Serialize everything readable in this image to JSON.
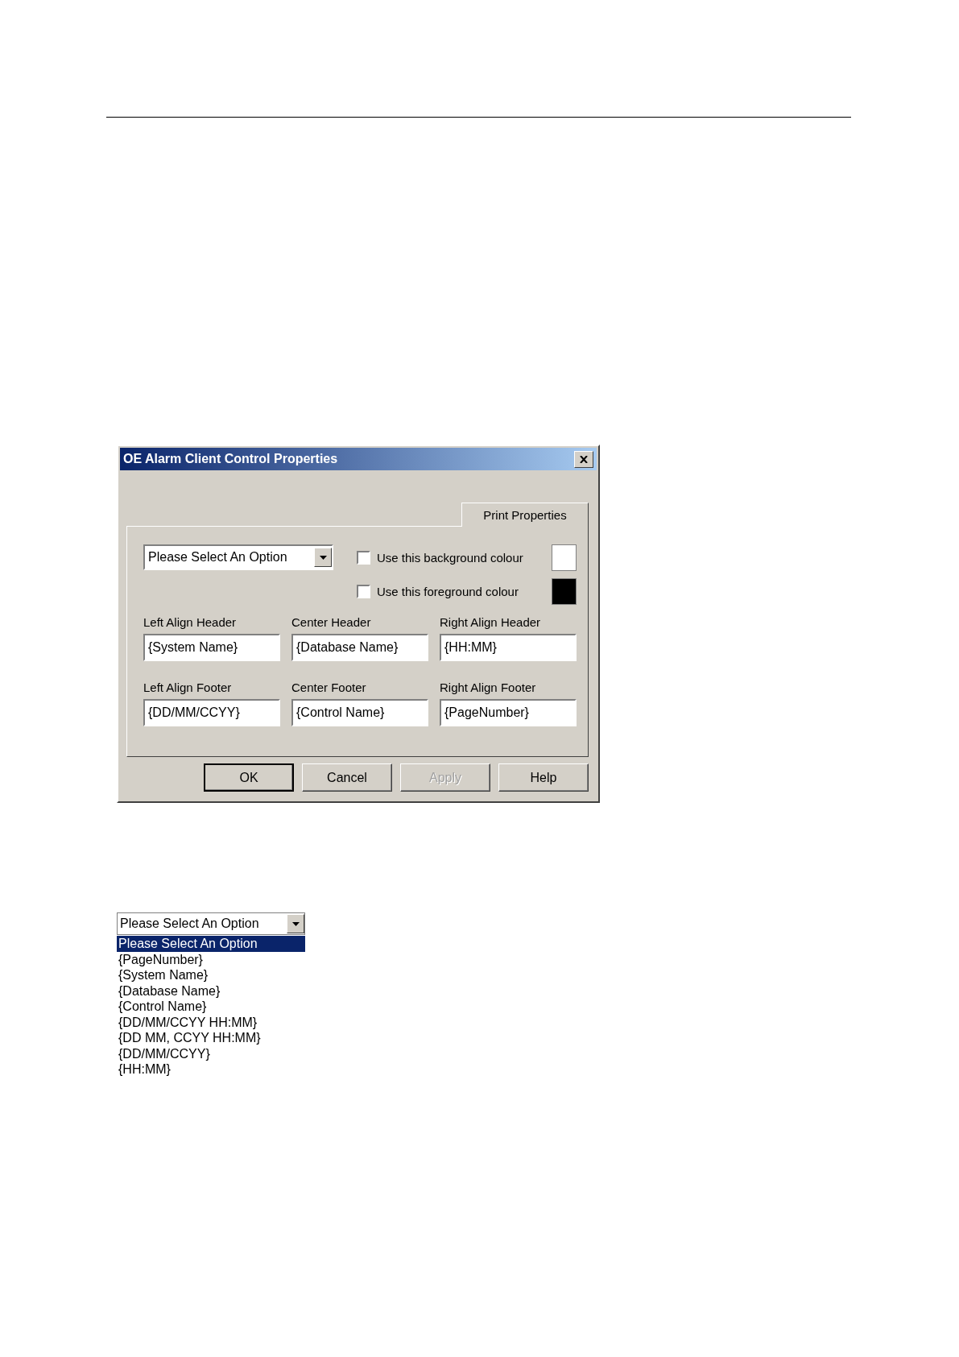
{
  "dialog": {
    "title": "OE Alarm Client Control Properties",
    "tabs": [
      {
        "label": "Print Properties",
        "selected": true
      }
    ],
    "option_select": {
      "value": "Please Select An Option"
    },
    "colour_options": [
      {
        "label": "Use this background colour",
        "checked": false,
        "color": "#ffffff"
      },
      {
        "label": "Use this foreground colour",
        "checked": false,
        "color": "#000000"
      }
    ],
    "fields": [
      {
        "label": "Left Align Header",
        "value": "{System Name}"
      },
      {
        "label": "Center Header",
        "value": "{Database Name}"
      },
      {
        "label": "Right Align Header",
        "value": "{HH:MM}"
      },
      {
        "label": "Left Align Footer",
        "value": "{DD/MM/CCYY}"
      },
      {
        "label": "Center Footer",
        "value": "{Control Name}"
      },
      {
        "label": "Right Align Footer",
        "value": "{PageNumber}"
      }
    ],
    "buttons": [
      {
        "label": "OK",
        "default": true,
        "disabled": false
      },
      {
        "label": "Cancel",
        "default": false,
        "disabled": false
      },
      {
        "label": "Apply",
        "default": false,
        "disabled": true
      },
      {
        "label": "Help",
        "default": false,
        "disabled": false
      }
    ]
  },
  "dropdown_demo": {
    "value": "Please Select An Option",
    "options": [
      {
        "label": "Please Select An Option",
        "selected": true
      },
      {
        "label": "{PageNumber}",
        "selected": false
      },
      {
        "label": "{System Name}",
        "selected": false
      },
      {
        "label": "{Database Name}",
        "selected": false
      },
      {
        "label": "{Control Name}",
        "selected": false
      },
      {
        "label": "{DD/MM/CCYY HH:MM}",
        "selected": false
      },
      {
        "label": "{DD MM, CCYY HH:MM}",
        "selected": false
      },
      {
        "label": "{DD/MM/CCYY}",
        "selected": false
      },
      {
        "label": "{HH:MM}",
        "selected": false
      }
    ]
  }
}
